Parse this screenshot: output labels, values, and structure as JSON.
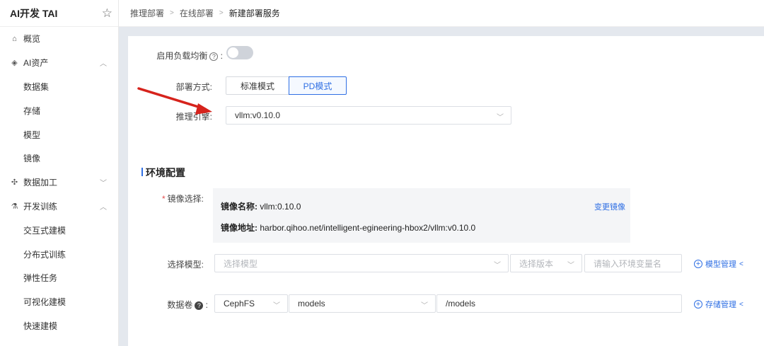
{
  "sidebar": {
    "title": "AI开发 TAI",
    "items": [
      {
        "label": "概览",
        "icon": "home-icon",
        "level": 0
      },
      {
        "label": "AI资产",
        "icon": "asset-icon",
        "level": 0,
        "expanded": true
      },
      {
        "label": "数据集",
        "level": 1
      },
      {
        "label": "存储",
        "level": 1
      },
      {
        "label": "模型",
        "level": 1
      },
      {
        "label": "镜像",
        "level": 1
      },
      {
        "label": "数据加工",
        "icon": "data-process-icon",
        "level": 0,
        "expanded": false
      },
      {
        "label": "开发训练",
        "icon": "train-icon",
        "level": 0,
        "expanded": true
      },
      {
        "label": "交互式建模",
        "level": 1
      },
      {
        "label": "分布式训练",
        "level": 1
      },
      {
        "label": "弹性任务",
        "level": 1
      },
      {
        "label": "可视化建模",
        "level": 1
      },
      {
        "label": "快速建模",
        "level": 1
      }
    ]
  },
  "breadcrumb": [
    "推理部署",
    "在线部署",
    "新建部署服务"
  ],
  "form": {
    "load_balance_label": "启用负载均衡",
    "load_balance_enabled": false,
    "deploy_mode_label": "部署方式:",
    "deploy_modes": [
      "标准模式",
      "PD模式"
    ],
    "deploy_mode_selected": "PD模式",
    "engine_label": "推理引擎:",
    "engine_value": "vllm:v0.10.0"
  },
  "env": {
    "section_title": "环境配置",
    "mirror_label": "镜像选择:",
    "mirror_name_key": "镜像名称:",
    "mirror_name_value": "vllm:0.10.0",
    "mirror_change_link": "变更镜像",
    "mirror_addr_key": "镜像地址:",
    "mirror_addr_value": "harbor.qihoo.net/intelligent-egineering-hbox2/vllm:v0.10.0",
    "model_label": "选择模型:",
    "model_placeholder": "选择模型",
    "version_placeholder": "选择版本",
    "env_var_placeholder": "请输入环境变量名",
    "model_manage_link": "模型管理",
    "volume_label": "数据卷",
    "volume_type": "CephFS",
    "volume_name": "models",
    "volume_path": "/models",
    "storage_manage_link": "存储管理"
  },
  "colors": {
    "accent": "#2f6fe4",
    "annotation_arrow": "#d6231c"
  }
}
